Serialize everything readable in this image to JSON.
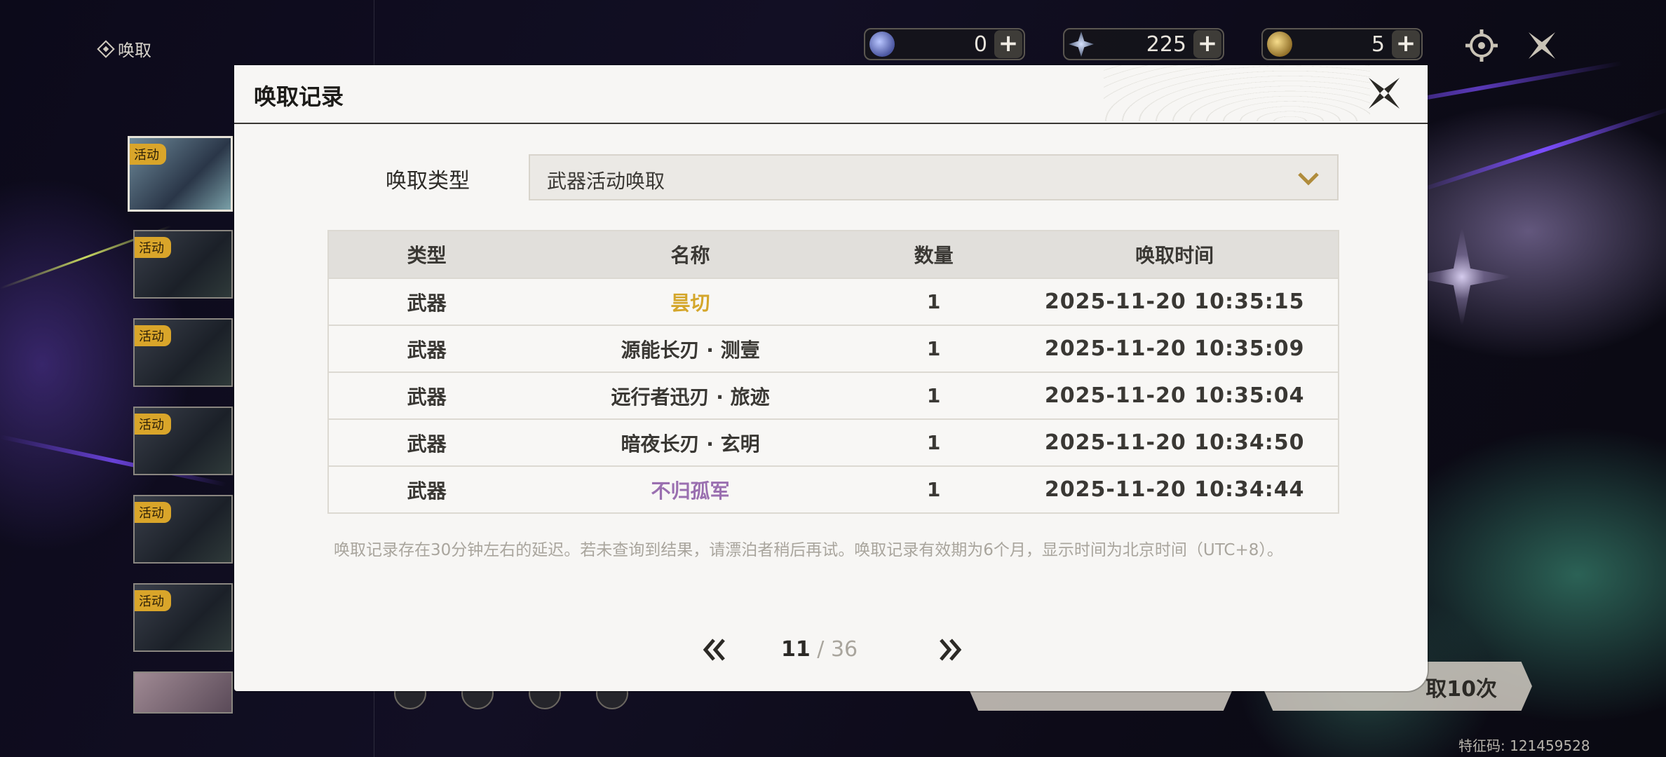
{
  "top_label": "唤取",
  "currencies": [
    {
      "icon": "orb-currency-icon",
      "value": "0",
      "plus": "+"
    },
    {
      "icon": "star-currency-icon",
      "value": "225",
      "plus": "+"
    },
    {
      "icon": "coin-currency-icon",
      "value": "5",
      "plus": "+"
    }
  ],
  "side_banners": [
    {
      "tag": "活动"
    },
    {
      "tag": "活动"
    },
    {
      "tag": "活动"
    },
    {
      "tag": "活动"
    },
    {
      "tag": "活动"
    },
    {
      "tag": "活动"
    }
  ],
  "bottom": {
    "pull_10_label": "取10次",
    "uid": "特征码: 121459528"
  },
  "modal": {
    "title": "唤取记录",
    "type_label": "唤取类型",
    "dropdown_value": "武器活动唤取",
    "columns": [
      "类型",
      "名称",
      "数量",
      "唤取时间"
    ],
    "rows": [
      {
        "type": "武器",
        "name": "昙切",
        "count": "1",
        "time": "2025-11-20 10:35:15",
        "name_color": "#d4a62a"
      },
      {
        "type": "武器",
        "name": "源能长刃 · 测壹",
        "count": "1",
        "time": "2025-11-20 10:35:09",
        "name_color": "#3a3834"
      },
      {
        "type": "武器",
        "name": "远行者迅刃 · 旅迹",
        "count": "1",
        "time": "2025-11-20 10:35:04",
        "name_color": "#3a3834"
      },
      {
        "type": "武器",
        "name": "暗夜长刃 · 玄明",
        "count": "1",
        "time": "2025-11-20 10:34:50",
        "name_color": "#3a3834"
      },
      {
        "type": "武器",
        "name": "不归孤军",
        "count": "1",
        "time": "2025-11-20 10:34:44",
        "name_color": "#9a6fb0"
      }
    ],
    "note": "唤取记录存在30分钟左右的延迟。若未查询到结果，请漂泊者稍后再试。唤取记录有效期为6个月，显示时间为北京时间（UTC+8）。",
    "pagination": {
      "current": "11",
      "separator": " / ",
      "total": "36"
    }
  }
}
